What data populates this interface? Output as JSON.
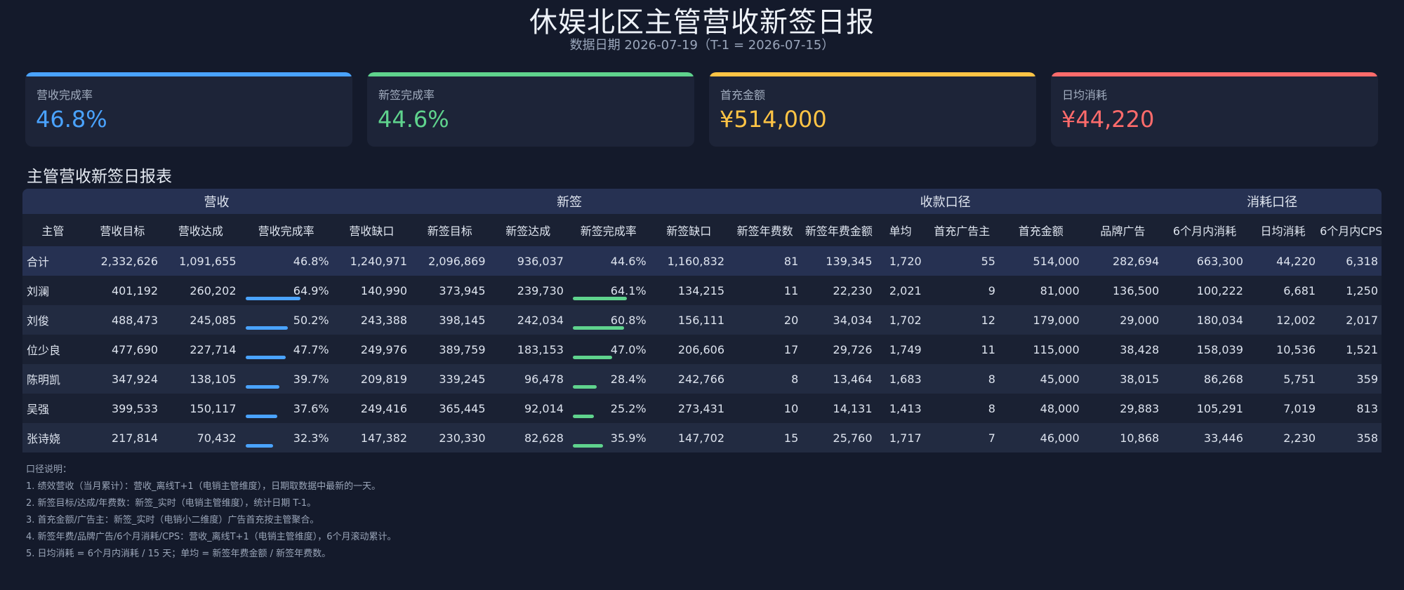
{
  "header": {
    "title": "休娱北区主管营收新签日报",
    "subtitle": "数据日期 2026-07-19（T-1 = 2026-07-15）"
  },
  "kpis": [
    {
      "label": "营收完成率",
      "value": "46.8%",
      "color": "#4aa3ff"
    },
    {
      "label": "新签完成率",
      "value": "44.6%",
      "color": "#5fd38d"
    },
    {
      "label": "首充金额",
      "value": "¥514,000",
      "color": "#ffc445"
    },
    {
      "label": "日均消耗",
      "value": "¥44,220",
      "color": "#ff6b6b"
    }
  ],
  "section_title": "主管营收新签日报表",
  "groups": [
    "营收",
    "新签",
    "收款口径",
    "消耗口径"
  ],
  "columns": [
    "主管",
    "营收目标",
    "营收达成",
    "营收完成率",
    "营收缺口",
    "新签目标",
    "新签达成",
    "新签完成率",
    "新签缺口",
    "新签年费数",
    "新签年费金额",
    "单均",
    "首充广告主",
    "首充金额",
    "品牌广告",
    "6个月内消耗",
    "日均消耗",
    "6个月内CPS"
  ],
  "total_row": [
    "合计",
    "2,332,626",
    "1,091,655",
    "46.8%",
    "1,240,971",
    "2,096,869",
    "936,037",
    "44.6%",
    "1,160,832",
    "81",
    "139,345",
    "1,720",
    "55",
    "514,000",
    "282,694",
    "663,300",
    "44,220",
    "6,318"
  ],
  "rows": [
    [
      "刘澜",
      "401,192",
      "260,202",
      "64.9%",
      "140,990",
      "373,945",
      "239,730",
      "64.1%",
      "134,215",
      "11",
      "22,230",
      "2,021",
      "9",
      "81,000",
      "136,500",
      "100,222",
      "6,681",
      "1,250"
    ],
    [
      "刘俊",
      "488,473",
      "245,085",
      "50.2%",
      "243,388",
      "398,145",
      "242,034",
      "60.8%",
      "156,111",
      "20",
      "34,034",
      "1,702",
      "12",
      "179,000",
      "29,000",
      "180,034",
      "12,002",
      "2,017"
    ],
    [
      "位少良",
      "477,690",
      "227,714",
      "47.7%",
      "249,976",
      "389,759",
      "183,153",
      "47.0%",
      "206,606",
      "17",
      "29,726",
      "1,749",
      "11",
      "115,000",
      "38,428",
      "158,039",
      "10,536",
      "1,521"
    ],
    [
      "陈明凯",
      "347,924",
      "138,105",
      "39.7%",
      "209,819",
      "339,245",
      "96,478",
      "28.4%",
      "242,766",
      "8",
      "13,464",
      "1,683",
      "8",
      "45,000",
      "38,015",
      "86,268",
      "5,751",
      "359"
    ],
    [
      "吴强",
      "399,533",
      "150,117",
      "37.6%",
      "249,416",
      "365,445",
      "92,014",
      "25.2%",
      "273,431",
      "10",
      "14,131",
      "1,413",
      "8",
      "48,000",
      "29,883",
      "105,291",
      "7,019",
      "813"
    ],
    [
      "张诗娆",
      "217,814",
      "70,432",
      "32.3%",
      "147,382",
      "230,330",
      "82,628",
      "35.9%",
      "147,702",
      "15",
      "25,760",
      "1,717",
      "7",
      "46,000",
      "10,868",
      "33,446",
      "2,230",
      "358"
    ]
  ],
  "bar_colors": {
    "revenue": "#4aa3ff",
    "signing": "#5fd38d"
  },
  "notes": [
    "口径说明：",
    "1. 绩效营收（当月累计）：营收_离线T+1（电销主管维度），日期取数据中最新的一天。",
    "2. 新签目标/达成/年费数：新签_实时（电销主管维度），统计日期 T-1。",
    "3. 首充金额/广告主：新签_实时（电销小二维度）广告首充按主管聚合。",
    "4. 新签年费/品牌广告/6个月消耗/CPS：营收_离线T+1（电销主管维度），6个月滚动累计。",
    "5. 日均消耗 = 6个月内消耗 / 15 天；单均 = 新签年费金额 / 新签年费数。"
  ]
}
